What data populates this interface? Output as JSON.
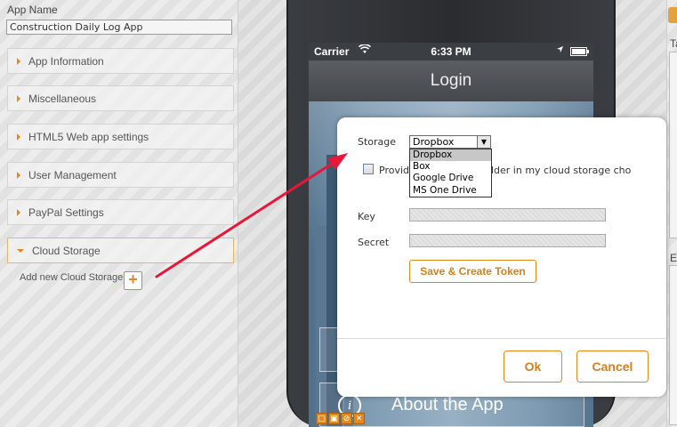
{
  "left_panel": {
    "app_name_label": "App Name",
    "app_name_value": "Construction Daily Log App",
    "sections": [
      {
        "label": "App Information"
      },
      {
        "label": "Miscellaneous"
      },
      {
        "label": "HTML5 Web app settings"
      },
      {
        "label": "User Management"
      },
      {
        "label": "PayPal Settings"
      },
      {
        "label": "Cloud Storage"
      }
    ],
    "add_cloud_storage_label": "Add new Cloud Storage",
    "add_button_glyph": "+"
  },
  "phone": {
    "carrier": "Carrier",
    "time": "6:33 PM",
    "nav_title": "Login",
    "about_button": "About the App",
    "about_icon_glyph": "i"
  },
  "right_panel": {
    "label_top": "Ta",
    "label_bottom": "El"
  },
  "dialog": {
    "storage_label": "Storage",
    "storage_selected": "Dropbox",
    "storage_options": [
      "Dropbox",
      "Box",
      "Google Drive",
      "MS One Drive"
    ],
    "provide_text": "Provide my own app folder in my cloud storage cho",
    "key_label": "Key",
    "key_value": "",
    "secret_label": "Secret",
    "secret_value": "",
    "token_button": "Save & Create Token",
    "ok_button": "Ok",
    "cancel_button": "Cancel"
  },
  "colors": {
    "accent": "#e08a1e",
    "annotation_arrow": "#e8173a"
  },
  "icons": {
    "wifi": "wifi-icon",
    "location": "location-arrow-icon",
    "battery": "battery-icon",
    "expand": "triangle-right-icon",
    "collapse": "triangle-down-icon"
  }
}
